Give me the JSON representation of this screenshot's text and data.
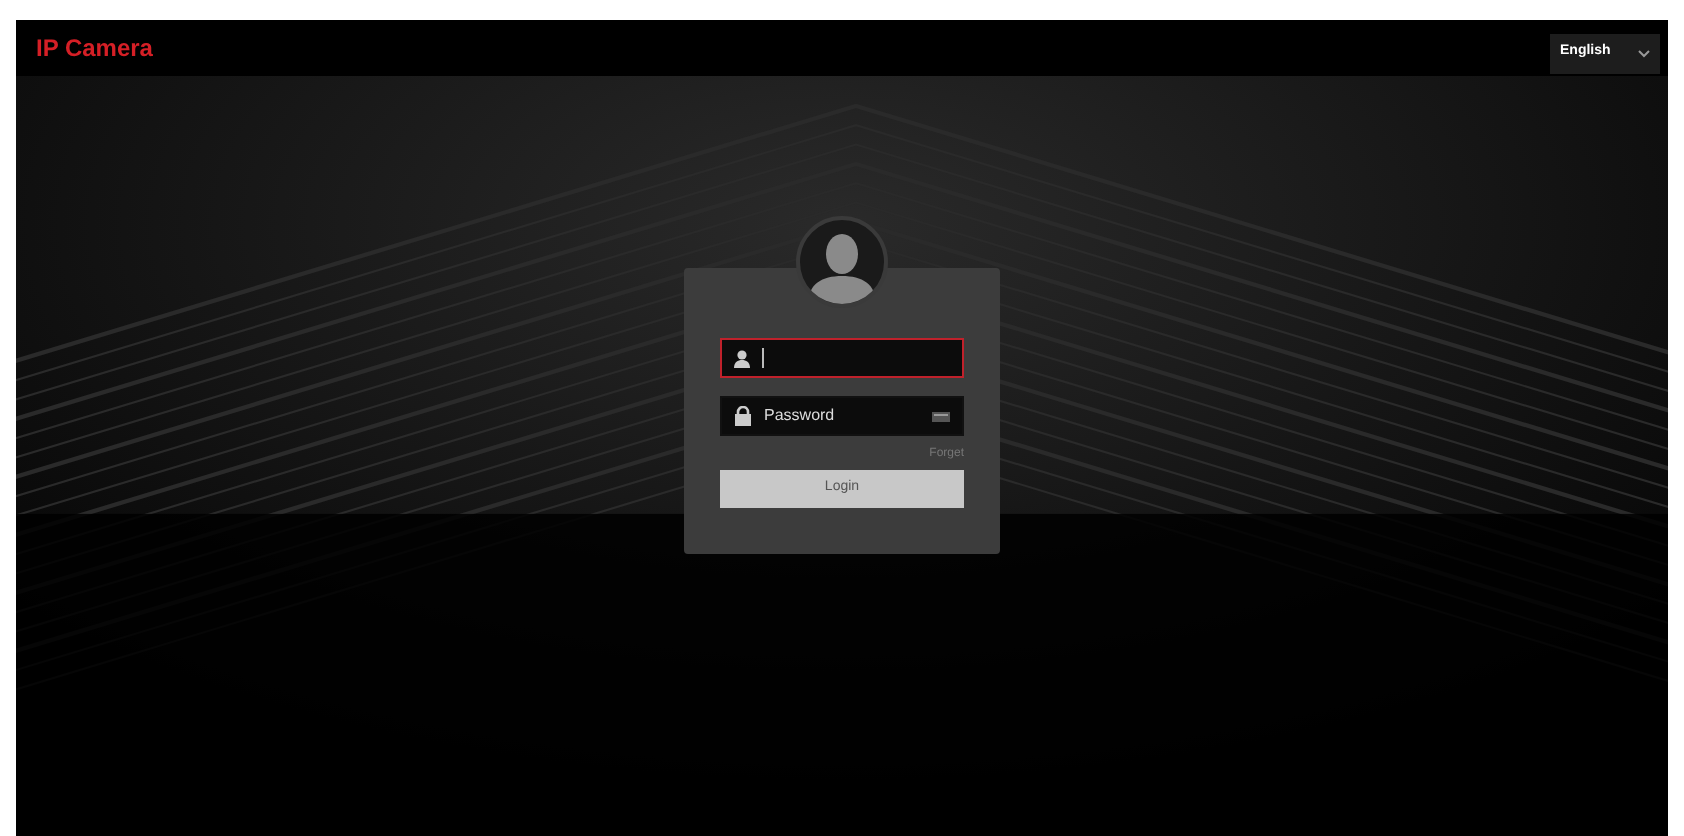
{
  "header": {
    "logo": "IP Camera",
    "language": {
      "value": "English"
    }
  },
  "login": {
    "fields": [
      {
        "kind": "username",
        "focused": true
      },
      {
        "kind": "password",
        "placeholder": "Password",
        "focused": false
      }
    ],
    "forget_link": "Forget",
    "login_button": "Login"
  }
}
